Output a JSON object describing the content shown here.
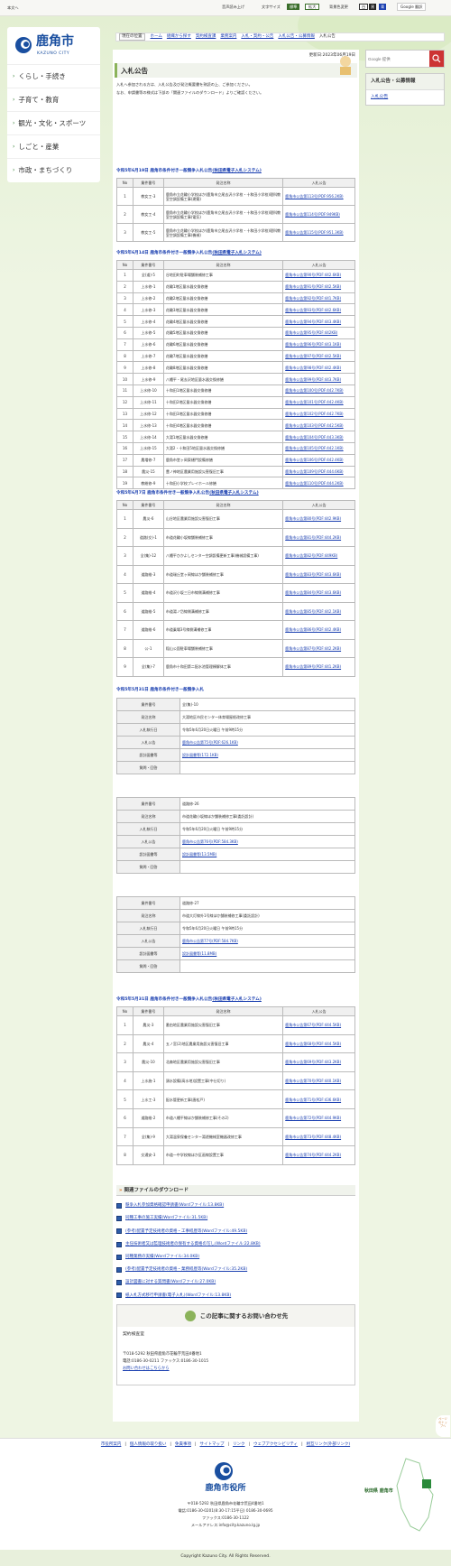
{
  "topbar": {
    "skip": "本文へ",
    "voice": "音声読み上げ",
    "size": "文字サイズ",
    "size_std": "標準",
    "size_big": "拡大",
    "color": "背景色変更",
    "c1": "白",
    "c2": "黒",
    "c3": "青",
    "translate": "Google 翻訳"
  },
  "logo": {
    "name": "鹿角市",
    "sub": "KAZUNO CITY"
  },
  "nav": [
    "くらし・手続き",
    "子育て・教育",
    "観光・文化・スポーツ",
    "しごと・産業",
    "市政・まちづくり"
  ],
  "breadcrumb": {
    "label": "現在の位置",
    "items": [
      "ホーム",
      "組織から探す",
      "契約検査課",
      "業務案内",
      "入札・契約・公告",
      "入札公告・公募情報",
      "入札公告"
    ]
  },
  "search": {
    "placeholder": "Google 提供"
  },
  "right": {
    "title": "入札公告・公募情報",
    "link": "入札公告"
  },
  "page": {
    "updated": "更新日:2023年06月19日",
    "title": "入札公告",
    "intro1": "入札へ参加される方は、入札公告及び発注概要書を熟読の上、ご参加ください。",
    "intro2": "なお、申請書等の様式は下部の「関連ファイルのダウンロード」よりご確認ください。"
  },
  "sec1": {
    "title": "令和5年6月19日 鹿角市条件付き一般競争入札公告",
    "link": "(秋田県電子入札システム)",
    "cols": [
      "No",
      "業件番号",
      "発注名称",
      "入札公告"
    ],
    "rows": [
      [
        "1",
        "教女工-3",
        "鹿角市立花輪小学校ほか(鹿角市立尾去沢小学校・十和田小学校)理科教室空調設備工事(建築)",
        "鹿角市公告第113号(PDF:956.2KB)"
      ],
      [
        "2",
        "教女工-4",
        "鹿角市立花輪小学校ほか(鹿角市立尾去沢小学校・十和田小学校)理科教室空調設備工事(電気)",
        "鹿角市公告第114号(PDF:949KB)"
      ],
      [
        "3",
        "教女工-5",
        "鹿角市立花輪小学校ほか(鹿角市立尾去沢小学校・十和田小学校)理科教室空調設備工事(機械)",
        "鹿角市公告第115号(PDF:951.3KB)"
      ]
    ]
  },
  "sec2": {
    "title": "令和5年6月14日 鹿角市条件付き一般競争入札公告",
    "link": "(秋田県電子入札システム)",
    "cols": [
      "No",
      "業件番号",
      "発注名称",
      "入札公告"
    ],
    "rows": [
      [
        "1",
        "全(道)-5",
        "谷地田町駐車場舗装補修工事",
        "鹿角市公告第90号(PDF:442.6KB)"
      ],
      [
        "2",
        "上水修-1",
        "花輪1地区量水器交換修繕",
        "鹿角市公告第91号(PDF:442.5KB)"
      ],
      [
        "3",
        "上水修-2",
        "花輪2地区量水器交換修繕",
        "鹿角市公告第92号(PDF:441.7KB)"
      ],
      [
        "4",
        "上水修-3",
        "花輪3地区量水器交換修繕",
        "鹿角市公告第93号(PDF:442.6KB)"
      ],
      [
        "5",
        "上水修-4",
        "花輪4地区量水器交換修繕",
        "鹿角市公告第94号(PDF:443.4KB)"
      ],
      [
        "6",
        "上水修-5",
        "花輪5地区量水器交換修繕",
        "鹿角市公告第95号(PDF:442KB)"
      ],
      [
        "7",
        "上水修-6",
        "花輪6地区量水器交換修繕",
        "鹿角市公告第96号(PDF:443.1KB)"
      ],
      [
        "8",
        "上水修-7",
        "花輪7地区量水器交換修繕",
        "鹿角市公告第97号(PDF:442.5KB)"
      ],
      [
        "9",
        "上水修-8",
        "花輪8地区量水器交換修繕",
        "鹿角市公告第98号(PDF:442.4KB)"
      ],
      [
        "10",
        "上水修-9",
        "八幡平・尾去沢地区量水器交換修繕",
        "鹿角市公告第99号(PDF:443.7KB)"
      ],
      [
        "11",
        "上水修-10",
        "十和田1地区量水器交換修繕",
        "鹿角市公告第100号(PDF:442.7KB)"
      ],
      [
        "12",
        "上水修-11",
        "十和田2地区量水器交換修繕",
        "鹿角市公告第101号(PDF:442.4KB)"
      ],
      [
        "13",
        "上水修-12",
        "十和田3地区量水器交換修繕",
        "鹿角市公告第102号(PDF:442.7KB)"
      ],
      [
        "14",
        "上水修-13",
        "十和田4地区量水器交換修繕",
        "鹿角市公告第103号(PDF:442.5KB)"
      ],
      [
        "15",
        "上水修-14",
        "大湯1地区量水器交換修繕",
        "鹿角市公告第104号(PDF:443.3KB)"
      ],
      [
        "16",
        "上水修-15",
        "大湯2・十和田5地区量水器交換修繕",
        "鹿角市公告第105号(PDF:442.1KB)"
      ],
      [
        "17",
        "農増修-7",
        "鹿角市堂ヶ岡東樋門設備修繕",
        "鹿角市公告第106号(PDF:442.4KB)"
      ],
      [
        "18",
        "農災-15",
        "豊ノ神地区農業用施設災害復旧工事",
        "鹿角市公告第109号(PDF:444.6KB)"
      ],
      [
        "19",
        "教総修-9",
        "十和田小学校プレイホール修繕",
        "鹿角市公告第110号(PDF:444.2KB)"
      ]
    ]
  },
  "sec3": {
    "title": "令和5年6月7日 鹿角市条件付き一般競争入札公告",
    "link": "(秋田県電子入札システム)",
    "cols": [
      "No",
      "業件番号",
      "発注名称",
      "入札公告"
    ],
    "rows": [
      [
        "1",
        "農災-6",
        "山谷地区農業用施設災害復旧工事",
        "鹿角市公告第80号(PDF:442.9KB)"
      ],
      [
        "2",
        "道路(交)-1",
        "市道花輪小坂線舗装補修工事",
        "鹿角市公告第81号(PDF:444.2KB)"
      ],
      [
        "3",
        "全(集)-12",
        "八幡平ひかよしセンター空調設備更新工事(機械設備工事)",
        "鹿角市公告第82号(PDF:449KB)"
      ],
      [
        "4",
        "道路維-3",
        "市道瑞丘堂ヶ岡線ほか舗装補修工事",
        "鹿角市公告第83号(PDF:443.6KB)"
      ],
      [
        "5",
        "道路維-4",
        "市道沢小坂三日市線側溝補修工事",
        "鹿角市公告第84号(PDF:443.6KB)"
      ],
      [
        "6",
        "道路維-5",
        "市道湯ノ岱線側溝補修工事",
        "鹿角市公告第85号(PDF:442.1KB)"
      ],
      [
        "7",
        "道路維-6",
        "市道乗場3号線側溝補修工事",
        "鹿角市公告第86号(PDF:442.4KB)"
      ],
      [
        "8",
        "公-1",
        "稲山公園駐車場舗装補修工事",
        "鹿角市公告第87号(PDF:442.2KB)"
      ],
      [
        "9",
        "全(集)-7",
        "鹿角市十和田第二配水池管理棟解体工事",
        "鹿角市公告第89号(PDF:441.2KB)"
      ]
    ]
  },
  "sec4": {
    "title": "令和5年5月31日 鹿角市条件付き一般競争入札",
    "keys": [
      "業件番号",
      "発注名称",
      "入札執行日",
      "入札公告",
      "設計図書等",
      "質問・回答"
    ],
    "boxes": [
      {
        "no": "全(集)-10",
        "name": "大湯地区市民センター体育場屋根改修工事",
        "date": "令和5年6月20日火曜日 午前9時15分",
        "notice": "鹿角市公告第75号(PDF:626.1KB)",
        "design": "設計図書等(172.1KB)",
        "qa": ""
      },
      {
        "no": "道路修-26",
        "name": "市道花輪小坂線ほか舗装補修工事(委託設計)",
        "date": "令和5年6月20日火曜日 午前9時15分",
        "notice": "鹿角市公告第76号(PDF:584.3KB)",
        "design": "設計図書等(13.5MB)",
        "qa": ""
      },
      {
        "no": "道路修-27",
        "name": "市道大灯線外1号線ほか舗装補修工事(委託設計)",
        "date": "令和5年6月20日火曜日 午前9時15分",
        "notice": "鹿角市公告第77号(PDF:584.7KB)",
        "design": "設計図書等(11.8MB)",
        "qa": ""
      }
    ]
  },
  "sec5": {
    "title": "令和5年5月31日 鹿角市条件付き一般競争入札公告",
    "link": "(秋田県電子入札システム)",
    "cols": [
      "No",
      "業件番号",
      "発注名称",
      "入札公告"
    ],
    "rows": [
      [
        "1",
        "農災-3",
        "番由地区農業用施設災害復旧工事",
        "鹿角市公告第67号(PDF:444.5KB)"
      ],
      [
        "2",
        "農災-4",
        "五ノ宮(2)地区農業用施設災害復旧工事",
        "鹿角市公告第68号(PDF:444.5KB)"
      ],
      [
        "3",
        "農災-10",
        "北森地区農業用施設災害復旧工事",
        "鹿角市公告第69号(PDF:443.2KB)"
      ],
      [
        "4",
        "上水施-1",
        "頭水設備(高水地)設置工事(中仕切り)",
        "鹿角市公告第70号(PDF:440.1KB)"
      ],
      [
        "5",
        "上水工-3",
        "配水管更新工事(唐松戸)",
        "鹿角市公告第71号(PDF:436.6KB)"
      ],
      [
        "6",
        "道路維-2",
        "市道八幡平線ほか舗装補修工事(その2)",
        "鹿角市公告第72号(PDF:444.9KB)"
      ],
      [
        "7",
        "全(集)-9",
        "大湯温泉保養センター湯遊機械室機器改修工事",
        "鹿角市公告第73号(PDF:448.4KB)"
      ],
      [
        "8",
        "交通安-3",
        "市道一中学校線ほか区画線設置工事",
        "鹿角市公告第74号(PDF:444.2KB)"
      ]
    ]
  },
  "downloads": {
    "title": "関連ファイルのダウンロード",
    "items": [
      "競争入札参加資格確認申請書(Wordファイル:13.8KB)",
      "同種工事の施工実績(Wordファイル:31.5KB)",
      "(参考)配置予定技術者の資格・工事経歴等(Wordファイル:49.5KB)",
      "主任技術者又は監理技術者の保有する資格の写し(Wordファイル:22.8KB)",
      "同種業務の実績(Wordファイル:34.0KB)",
      "(参考)配置予定技術者の資格・業務経歴等(Wordファイル:35.2KB)",
      "設計図書に対する質問書(Wordファイル:27.0KB)",
      "紙入札方式移行申請書(電子入札)(Wordファイル:13.8KB)",
      "紙入札方式参加承諾書(電子入札)(Wordファイル:13.9KB)",
      "電子入札委任状(Wordファイル:13.8KB)"
    ]
  },
  "contact": {
    "title": "この記事に関するお問い合わせ先",
    "dept": "契約検査室",
    "addr": "〒018-5292 秋田県鹿角市花輪字荒田4番地1",
    "tel": "電話:0186-30-0211 ファックス:0186-30-1015",
    "link": "お問い合わせはこちらから"
  },
  "pdf": {
    "badge": "Get Adobe Acrobat Reader",
    "text": "PDFファイルを閲覧するには「Adobe Reader(Acrobat Reader)」が必要です。お持ちでない方は、左記の「Adobe Reader(Acrobat Reader)ダウンロード」ボタンをクリックして、ソフトウェアをダウンロードし、インストールしてください。"
  },
  "pagetop": "ページのトップへ",
  "footer": {
    "links": [
      "市役所案内",
      "個人情報の取り扱い",
      "免責事項",
      "サイトマップ",
      "リンク",
      "ウェブアクセシビリティ",
      "相互リンク(外部リンク)"
    ],
    "name": "鹿角市役所",
    "addr": "〒018-5292 秋田県鹿角市花輪字荒田4番地1",
    "tel": "電話:0186-30-0201(8:30-17:15平日) 0186-30-0695",
    "fax": "ファックス:0186-30-1122",
    "mail": "メールアドレス:info@city.kazuno.lg.jp",
    "mapcap": "秋田県 鹿角市",
    "copy": "Copyright Kazuno City. All Rights Reserved."
  }
}
